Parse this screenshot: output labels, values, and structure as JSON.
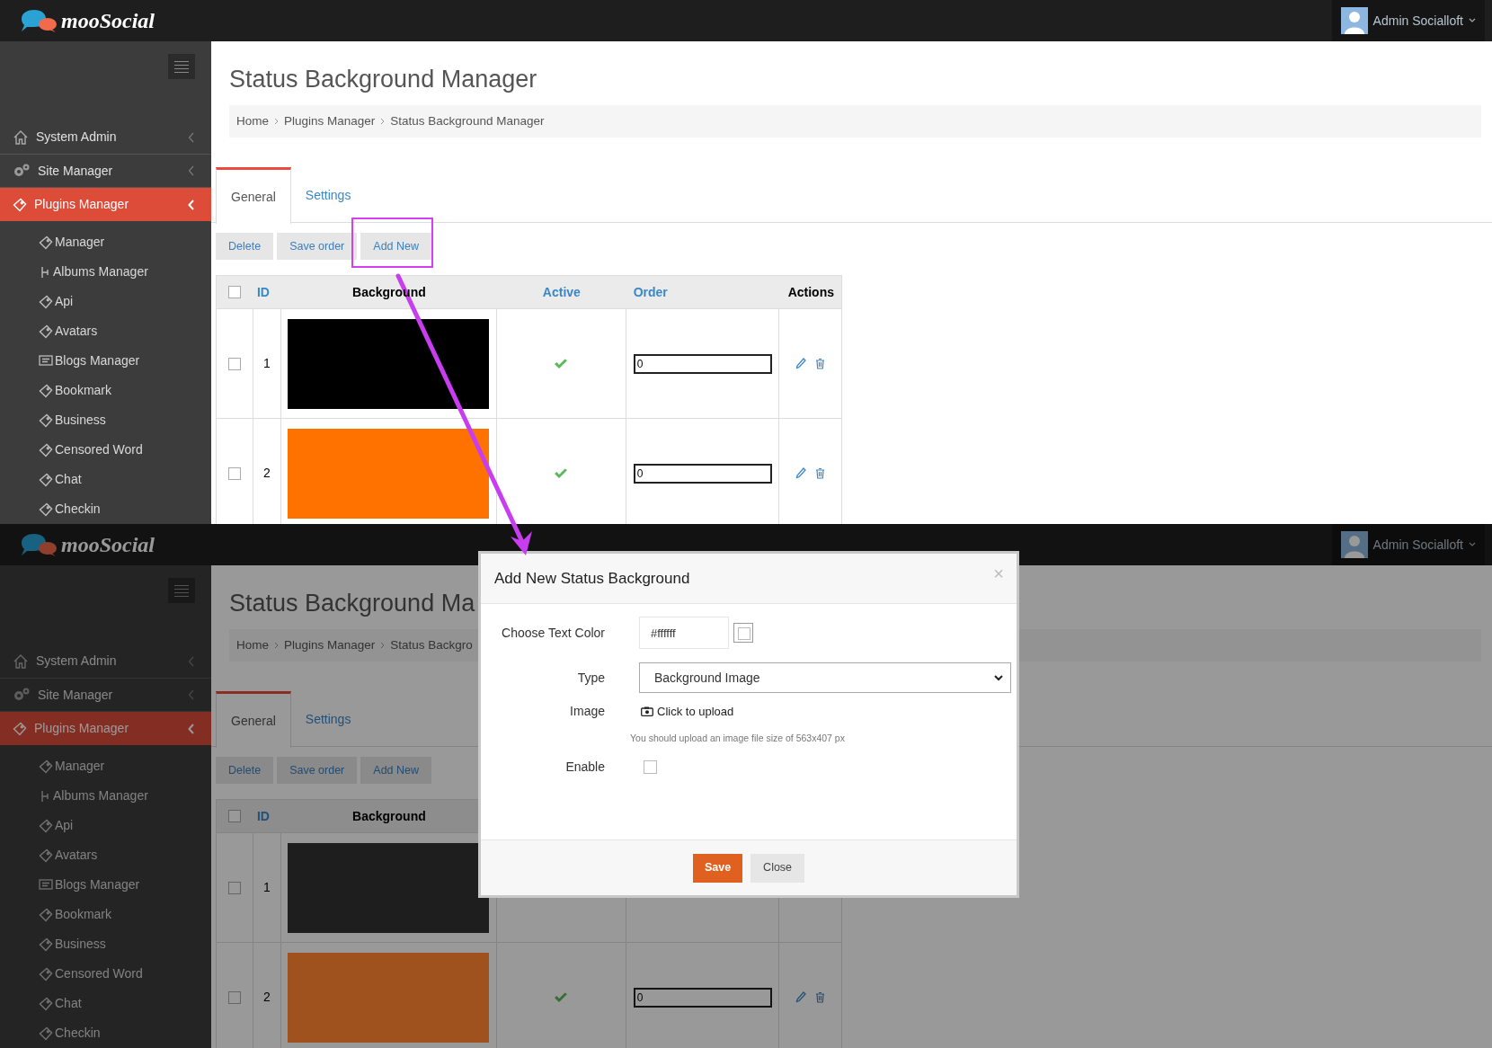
{
  "screens": [
    {
      "topbar": {
        "logo": "mooSocial",
        "user": "Admin Socialloft"
      },
      "sidebar": {
        "items": [
          {
            "label": "System Admin",
            "selected": false
          },
          {
            "label": "Site Manager",
            "selected": false
          },
          {
            "label": "Plugins Manager",
            "selected": true
          }
        ],
        "subitems": [
          {
            "label": "Manager"
          },
          {
            "label": "Albums Manager"
          },
          {
            "label": "Api"
          },
          {
            "label": "Avatars"
          },
          {
            "label": "Blogs Manager"
          },
          {
            "label": "Bookmark"
          },
          {
            "label": "Business"
          },
          {
            "label": "Censored Word"
          },
          {
            "label": "Chat"
          },
          {
            "label": "Checkin"
          }
        ]
      },
      "page_title": "Status Background Manager",
      "breadcrumb": [
        "Home",
        "Plugins Manager",
        "Status Background Manager"
      ],
      "tabs": [
        {
          "label": "General",
          "selected": true
        },
        {
          "label": "Settings",
          "selected": false
        }
      ],
      "buttons": [
        "Delete",
        "Save order",
        "Add New"
      ],
      "table": {
        "all_checked": false,
        "columns": [
          {
            "label": "ID",
            "link": true
          },
          {
            "label": "Background",
            "link": false
          },
          {
            "label": "Active",
            "link": true
          },
          {
            "label": "Order",
            "link": true
          },
          {
            "label": "Actions",
            "link": false
          }
        ],
        "rows": [
          {
            "checked": false,
            "id": "1",
            "color": "#000000",
            "active": true,
            "order": "0"
          },
          {
            "checked": false,
            "id": "2",
            "color": "#ff7200",
            "active": true,
            "order": "0"
          }
        ]
      }
    },
    {
      "topbar": {
        "logo": "mooSocial",
        "user": "Admin Socialloft"
      },
      "sidebar": {
        "items": [
          {
            "label": "System Admin",
            "selected": false
          },
          {
            "label": "Site Manager",
            "selected": false
          },
          {
            "label": "Plugins Manager",
            "selected": true
          }
        ],
        "subitems": [
          {
            "label": "Manager"
          },
          {
            "label": "Albums Manager"
          },
          {
            "label": "Api"
          },
          {
            "label": "Avatars"
          },
          {
            "label": "Blogs Manager"
          },
          {
            "label": "Bookmark"
          },
          {
            "label": "Business"
          },
          {
            "label": "Censored Word"
          },
          {
            "label": "Chat"
          },
          {
            "label": "Checkin"
          }
        ]
      },
      "page_title": "Status Background Ma",
      "breadcrumb": [
        "Home",
        "Plugins Manager",
        "Status Backgro"
      ],
      "tabs": [
        {
          "label": "General",
          "selected": true
        },
        {
          "label": "Settings",
          "selected": false
        }
      ],
      "buttons": [
        "Delete",
        "Save order",
        "Add New"
      ],
      "table": {
        "all_checked": false,
        "columns": [
          {
            "label": "ID",
            "link": true
          },
          {
            "label": "Background",
            "link": false
          }
        ],
        "rows": [
          {
            "checked": false,
            "id": "1",
            "color": "#1e1e1e"
          },
          {
            "checked": false,
            "id": "2",
            "color": "#a0521e",
            "active": true,
            "order": "0"
          }
        ]
      },
      "dialog": {
        "title": "Add New Status Background",
        "close": "×",
        "fields": [
          {
            "kind": "color",
            "label": "Choose Text Color",
            "value": "#ffffff"
          },
          {
            "kind": "select",
            "label": "Type",
            "value": "Background Image"
          },
          {
            "kind": "upload",
            "label": "Image",
            "value": "Click to upload",
            "hint": "You should upload an image file size of 563x407 px"
          },
          {
            "kind": "checkbox",
            "label": "Enable",
            "checked": false
          }
        ],
        "buttons": [
          {
            "label": "Save",
            "kind": "primary"
          },
          {
            "label": "Close",
            "kind": "default"
          }
        ]
      }
    }
  ]
}
